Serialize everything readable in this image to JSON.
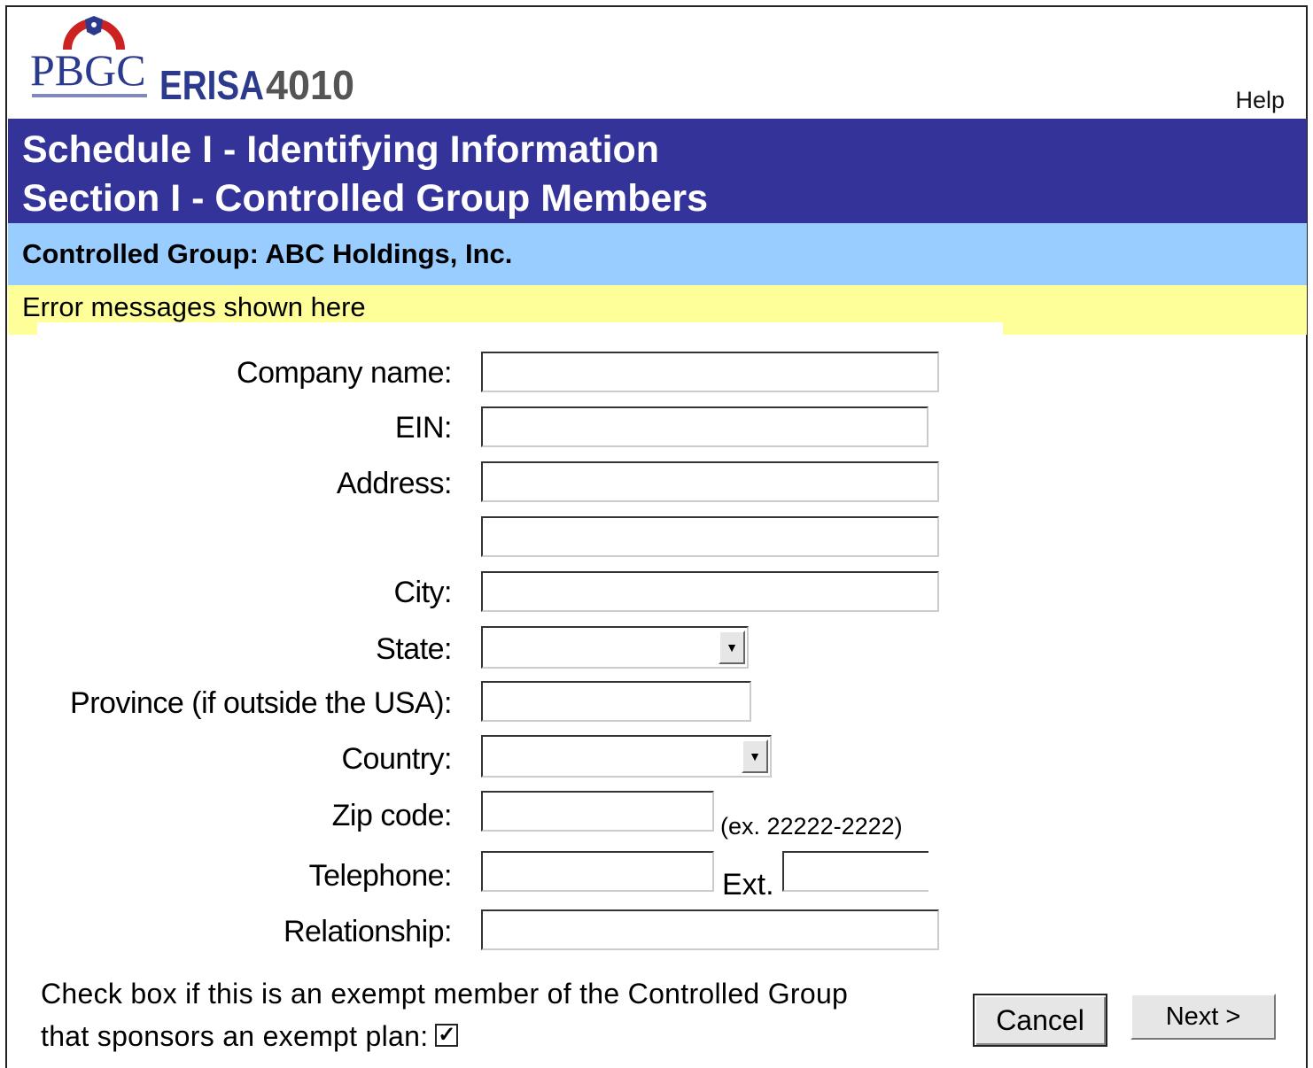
{
  "header": {
    "logo_text": "PBGC",
    "product_name": "ERISA",
    "product_number": "4010",
    "help_label": "Help"
  },
  "title": {
    "line1": "Schedule I - Identifying Information",
    "line2": "Section I - Controlled Group Members"
  },
  "group_label": "Controlled Group: ABC Holdings, Inc.",
  "error_message": "Error messages shown here",
  "form": {
    "company_name": {
      "label": "Company name:",
      "value": ""
    },
    "ein": {
      "label": "EIN:",
      "value": ""
    },
    "address": {
      "label": "Address:",
      "value1": "",
      "value2": ""
    },
    "city": {
      "label": "City:",
      "value": ""
    },
    "state": {
      "label": "State:",
      "value": ""
    },
    "province": {
      "label": "Province (if outside the USA):",
      "value": ""
    },
    "country": {
      "label": "Country:",
      "value": ""
    },
    "zip": {
      "label": "Zip code:",
      "value": "",
      "hint": "(ex. 22222-2222)"
    },
    "telephone": {
      "label": "Telephone:",
      "value": "",
      "ext_label": "Ext.",
      "ext_value": ""
    },
    "relationship": {
      "label": "Relationship:",
      "value": ""
    }
  },
  "exempt": {
    "line1": "Check box if this is an exempt member of the Controlled Group",
    "line2": "that sponsors an exempt plan:",
    "checked": true
  },
  "buttons": {
    "cancel": "Cancel",
    "next": "Next >"
  },
  "colors": {
    "title_bg": "#333399",
    "group_bg": "#99ccff",
    "error_bg": "#ffff99",
    "logo_blue": "#2b3a8c",
    "logo_red": "#cc2222"
  }
}
